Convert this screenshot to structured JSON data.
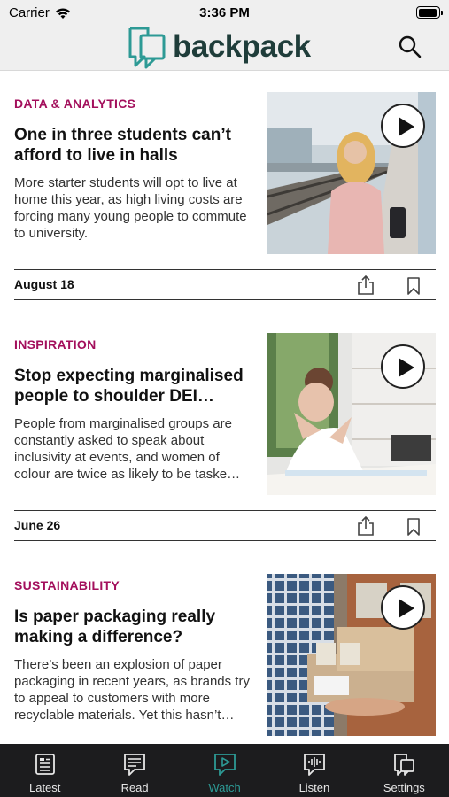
{
  "status_bar": {
    "carrier": "Carrier",
    "time": "3:36 PM",
    "battery_level": 0.95
  },
  "header": {
    "logo_text": "backpack",
    "brand_color": "#2d9a95",
    "logo_text_color": "#1f3d3a"
  },
  "articles": [
    {
      "category": "DATA & ANALYTICS",
      "category_color": "#a30f5c",
      "title": "One in three students can’t afford to live in halls",
      "summary": "More starter students will opt to live at home this year, as high living costs are forcing many young people to commute to university.",
      "date": "August 18",
      "media": "video"
    },
    {
      "category": "INSPIRATION",
      "category_color": "#a30f5c",
      "title": "Stop expecting marginalised people to shoulder DEI…",
      "summary": "People from marginalised groups are constantly asked to speak about inclusivity at events, and women of colour are twice as likely to be taske…",
      "date": "June 26",
      "media": "video"
    },
    {
      "category": "SUSTAINABILITY",
      "category_color": "#a30f5c",
      "title": "Is paper packaging really making a difference?",
      "summary": "There’s been an explosion of paper packaging in recent years, as brands try to appeal to customers with more recyclable materials. Yet this hasn’t…",
      "date": "",
      "media": "video"
    }
  ],
  "tab_bar": {
    "active_color": "#2d9a95",
    "tabs": [
      {
        "label": "Latest",
        "icon": "newspaper-icon",
        "active": false
      },
      {
        "label": "Read",
        "icon": "article-chat-icon",
        "active": false
      },
      {
        "label": "Watch",
        "icon": "video-chat-icon",
        "active": true
      },
      {
        "label": "Listen",
        "icon": "audio-wave-chat-icon",
        "active": false
      },
      {
        "label": "Settings",
        "icon": "settings-chat-icon",
        "active": false
      }
    ]
  }
}
